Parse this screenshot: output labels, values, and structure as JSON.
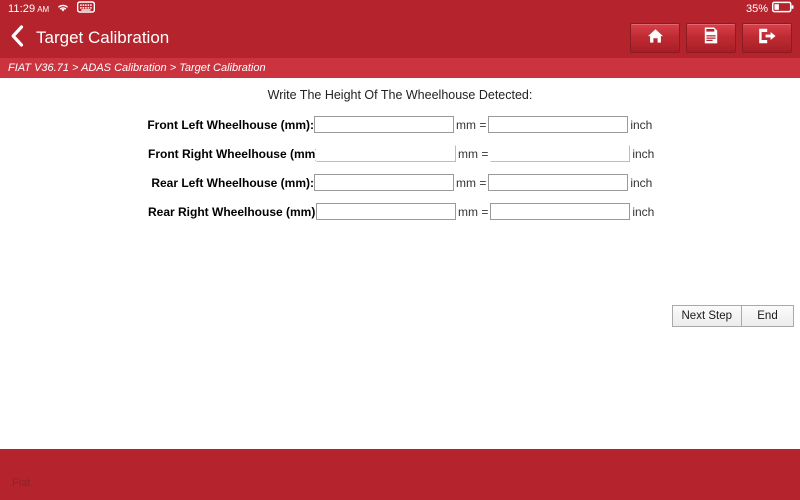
{
  "statusbar": {
    "time": "11:29",
    "ampm": "AM",
    "wifi_icon": "wifi-icon",
    "keyboard_icon": "keyboard-icon",
    "battery_percent": "35%",
    "battery_icon": "battery-icon"
  },
  "titlebar": {
    "back_icon": "chevron-left-icon",
    "title": "Target Calibration",
    "actions": [
      {
        "name": "home-button",
        "icon": "home-icon"
      },
      {
        "name": "report-button",
        "icon": "adas-report-icon"
      },
      {
        "name": "exit-button",
        "icon": "exit-icon"
      }
    ]
  },
  "breadcrumb": {
    "text": "FIAT V36.71 > ADAS Calibration > Target Calibration"
  },
  "main": {
    "prompt": "Write The Height Of The Wheelhouse Detected:",
    "unit_mm": "mm =",
    "unit_inch": "inch",
    "rows": [
      {
        "label": "Front Left Wheelhouse (mm):",
        "mm_value": "",
        "inch_value": "",
        "placeholder": ""
      },
      {
        "label": "Front Right Wheelhouse (mm):",
        "mm_value": "",
        "inch_value": "",
        "placeholder": ""
      },
      {
        "label": "Rear Left Wheelhouse (mm):",
        "mm_value": "",
        "inch_value": "",
        "placeholder": ""
      },
      {
        "label": "Rear Right Wheelhouse (mm):",
        "mm_value": "",
        "inch_value": "",
        "placeholder": ""
      }
    ]
  },
  "actions": {
    "next_step": "Next Step",
    "end": "End"
  },
  "footer": {
    "brand": "Fiat"
  },
  "colors": {
    "header_red": "#b5242c",
    "breadcrumb_red": "#cb333f",
    "footer_red": "#b5242c",
    "brand_text": "#8d2229",
    "field_border": "#9a9a9a"
  }
}
